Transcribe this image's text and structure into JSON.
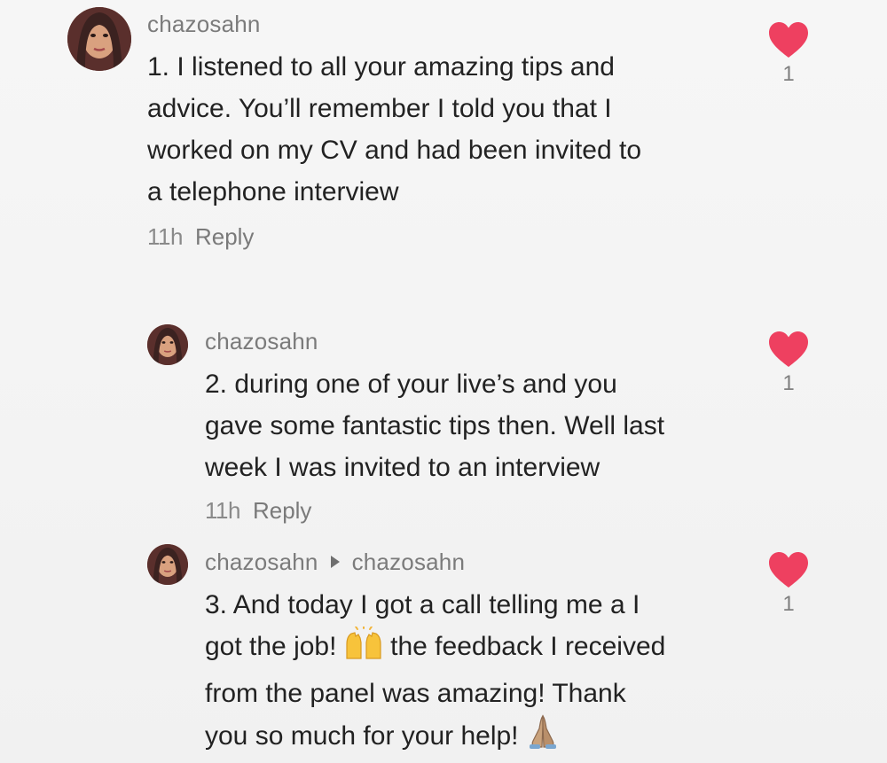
{
  "colors": {
    "heart": "#ee4060",
    "username": "#7b7b7b",
    "text": "#222222",
    "background": "#f4f4f4"
  },
  "comments": [
    {
      "username": "chazosahn",
      "lines": [
        "1. I listened to all your amazing tips and",
        "advice. You’ll remember I told you that I",
        "worked on my CV and had been invited to",
        "a telephone interview"
      ],
      "time": "11h",
      "reply": "Reply",
      "likes": "1"
    },
    {
      "username": "chazosahn",
      "lines": [
        "2. during one of your live’s and you",
        "gave some fantastic tips then. Well last",
        "week I was invited to an interview"
      ],
      "time": "11h",
      "reply": "Reply",
      "likes": "1"
    },
    {
      "username": "chazosahn",
      "reply_to": "chazosahn",
      "lines": [
        "3. And today I got a call telling me a I",
        "got the job!",
        "the feedback I received",
        "from the panel was amazing! Thank",
        "you so much for your help!"
      ],
      "emojis": [
        "raising-hands-emoji",
        "folded-hands-emoji"
      ],
      "likes": "1"
    }
  ]
}
